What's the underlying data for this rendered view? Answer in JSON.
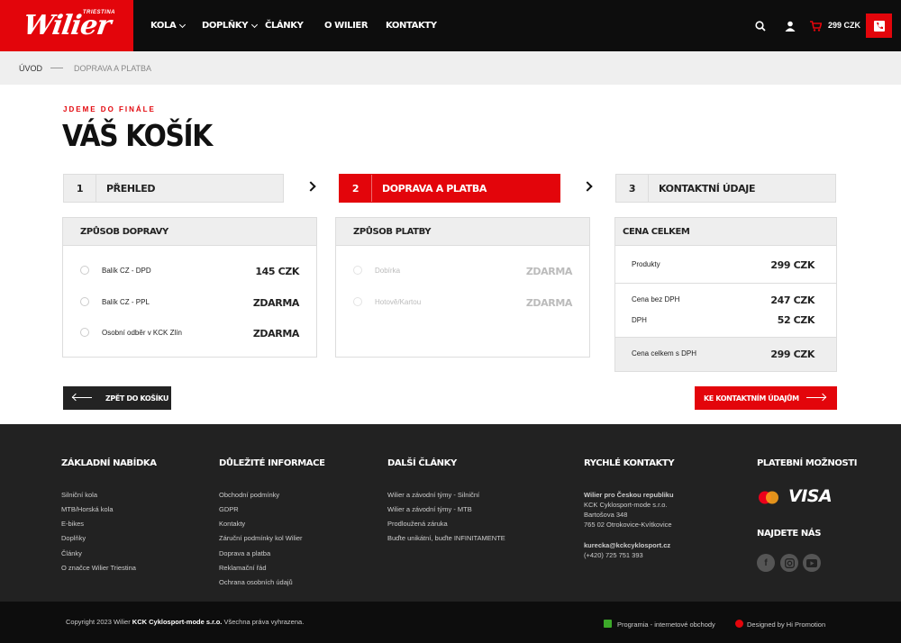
{
  "header": {
    "logo": "Wilier",
    "logo_sub": "TRIESTINA",
    "nav": [
      {
        "label": "KOLA",
        "has_dropdown": true
      },
      {
        "label": "DOPLŇKY",
        "has_dropdown": true
      },
      {
        "label": "ČLÁNKY",
        "has_dropdown": false
      },
      {
        "label": "O WILIER",
        "has_dropdown": false
      },
      {
        "label": "KONTAKTY",
        "has_dropdown": false
      }
    ],
    "cart_price": "299 CZK",
    "icons": [
      "search-icon",
      "user-icon",
      "cart-icon",
      "phone-icon"
    ]
  },
  "breadcrumb": {
    "home": "ÚVOD",
    "current": "DOPRAVA A PLATBA"
  },
  "page": {
    "kicker": "JDEME DO FINÁLE",
    "title": "VÁŠ KOŠÍK"
  },
  "steps": [
    {
      "num": "1",
      "label": "PŘEHLED",
      "active": false
    },
    {
      "num": "2",
      "label": "DOPRAVA A PLATBA",
      "active": true
    },
    {
      "num": "3",
      "label": "KONTAKTNÍ ÚDAJE",
      "active": false
    }
  ],
  "shipping": {
    "title": "ZPŮSOB DOPRAVY",
    "options": [
      {
        "label": "Balík CZ - DPD",
        "price": "145 CZK"
      },
      {
        "label": "Balík CZ - PPL",
        "price": "ZDARMA"
      },
      {
        "label": "Osobní odběr v KCK Zlín",
        "price": "ZDARMA"
      }
    ]
  },
  "payment": {
    "title": "ZPŮSOB PLATBY",
    "options": [
      {
        "label": "Dobírka",
        "price": "ZDARMA"
      },
      {
        "label": "Hotově/Kartou",
        "price": "ZDARMA"
      }
    ]
  },
  "summary": {
    "title": "CENA CELKEM",
    "products_label": "Produkty",
    "products_value": "299 CZK",
    "nodph_label": "Cena bez DPH",
    "nodph_value": "247 CZK",
    "dph_label": "DPH",
    "dph_value": "52 CZK",
    "total_label": "Cena celkem s DPH",
    "total_value": "299 CZK"
  },
  "buttons": {
    "back": "ZPĚT DO KOŠÍKU",
    "next": "KE KONTAKTNÍM ÚDAJŮM"
  },
  "footer": {
    "col1": {
      "title": "ZÁKLADNÍ NABÍDKA",
      "links": [
        "Silniční kola",
        "MTB/Horská kola",
        "E-bikes",
        "Doplňky",
        "Články",
        "O značce Wilier Triestina"
      ]
    },
    "col2": {
      "title": "DŮLEŽITÉ INFORMACE",
      "links": [
        "Obchodní podmínky",
        "GDPR",
        "Kontakty",
        "Záruční podmínky kol Wilier",
        "Doprava a platba",
        "Reklamační řád",
        "Ochrana osobních údajů"
      ]
    },
    "col3": {
      "title": "DALŠÍ ČLÁNKY",
      "links": [
        "Wilier a závodní týmy - Silniční",
        "Wilier a závodní týmy - MTB",
        "Prodloužená záruka",
        "Buďte unikátní, buďte INFINITAMENTE"
      ]
    },
    "col4": {
      "title": "RYCHLÉ KONTAKTY",
      "company_bold": "Wilier pro Českou republiku",
      "lines": [
        "KCK Cyklosport-mode s.r.o.",
        "Bartošova 348",
        "765 02 Otrokovice-Kvítkovice"
      ],
      "email": "kurecka@kckcyklosport.cz",
      "phone": "(+420) 725 751 393"
    },
    "col5": {
      "title": "PLATEBNÍ MOŽNOSTI",
      "visa": "VISA",
      "find_title": "NAJDETE NÁS",
      "socials": [
        "facebook-icon",
        "instagram-icon",
        "youtube-icon"
      ]
    }
  },
  "bottom": {
    "copyright_pre": "Copyright 2023 Wilier ",
    "copyright_bold": "KCK Cyklosport-mode s.r.o.",
    "copyright_post": " Všechna práva vyhrazena.",
    "programia": "Programia - internetové obchody",
    "designed": "Designed by Hi Promotion"
  }
}
